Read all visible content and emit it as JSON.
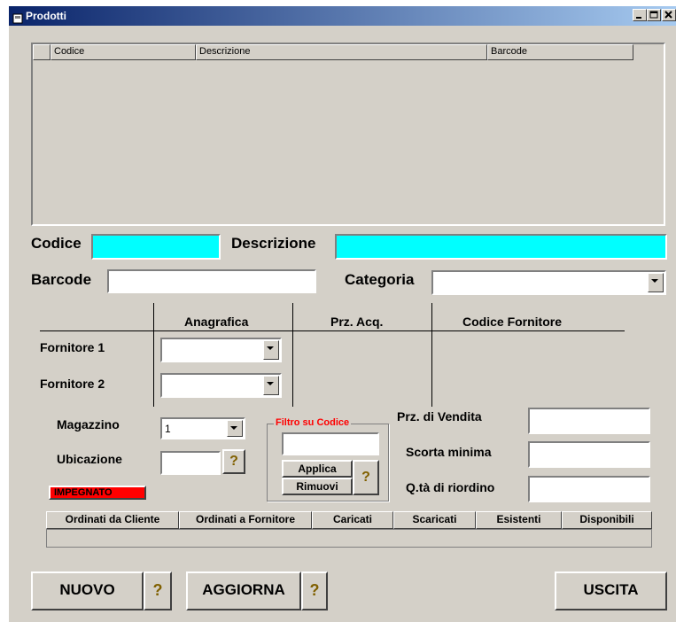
{
  "window": {
    "title": "Prodotti"
  },
  "grid": {
    "columns": [
      "Codice",
      "Descrizione",
      "Barcode"
    ]
  },
  "form": {
    "codice_label": "Codice",
    "descrizione_label": "Descrizione",
    "barcode_label": "Barcode",
    "categoria_label": "Categoria",
    "codice_value": "",
    "descrizione_value": "",
    "barcode_value": "",
    "categoria_value": ""
  },
  "suppliers": {
    "header_anagrafica": "Anagrafica",
    "header_prz_acq": "Prz. Acq.",
    "header_codice_fornitore": "Codice Fornitore",
    "fornitore1_label": "Fornitore 1",
    "fornitore2_label": "Fornitore 2"
  },
  "stock": {
    "magazzino_label": "Magazzino",
    "magazzino_value": "1",
    "ubicazione_label": "Ubicazione",
    "impegnato_badge": "IMPEGNATO"
  },
  "filter": {
    "group_label": "Filtro su Codice",
    "apply_label": "Applica",
    "remove_label": "Rimuovi"
  },
  "pricing": {
    "prz_vendita_label": "Prz. di Vendita",
    "scorta_minima_label": "Scorta minima",
    "qta_riordino_label": "Q.tà di riordino"
  },
  "summary": {
    "columns": [
      "Ordinati da Cliente",
      "Ordinati a Fornitore",
      "Caricati",
      "Scaricati",
      "Esistenti",
      "Disponibili"
    ]
  },
  "actions": {
    "nuovo_label": "NUOVO",
    "aggiorna_label": "AGGIORNA",
    "uscita_label": "USCITA",
    "help_glyph": "?"
  },
  "colors": {
    "cyan_field": "#00ffff",
    "badge_red": "#ff0000",
    "filter_red": "#ff0000",
    "face": "#d4d0c8"
  }
}
